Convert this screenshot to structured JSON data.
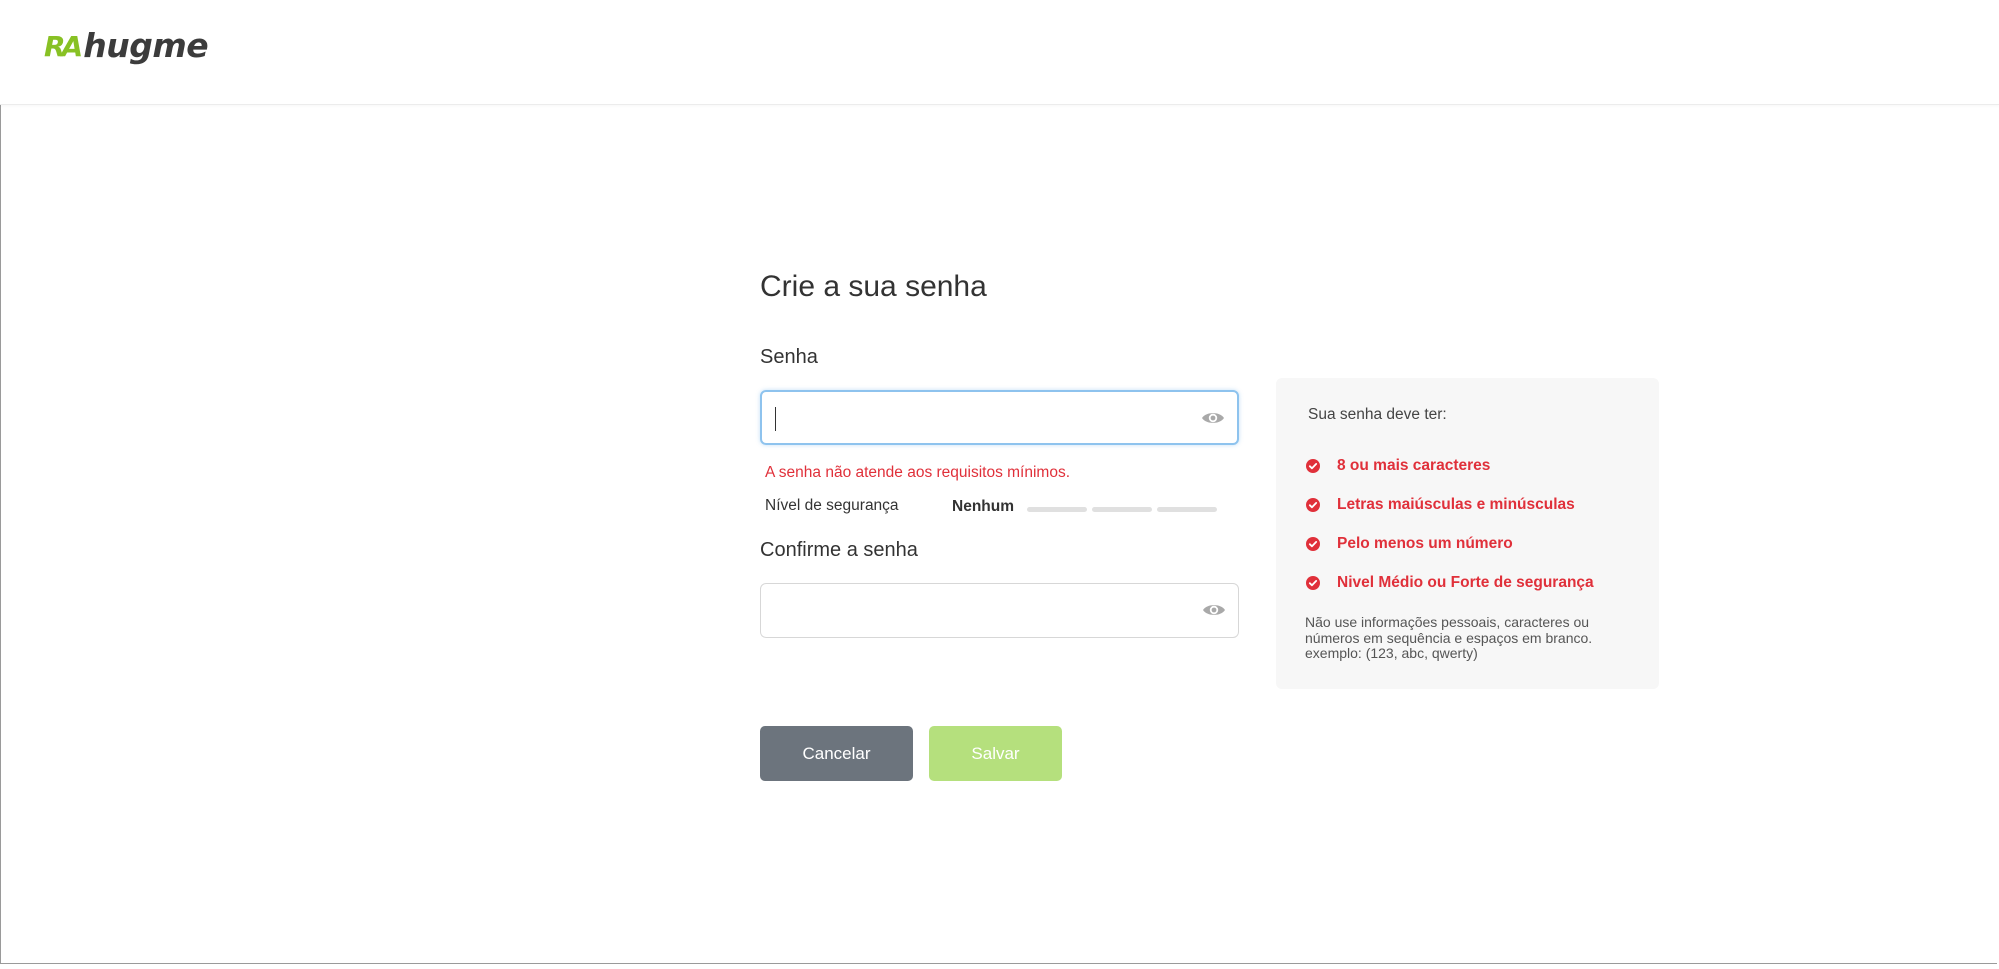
{
  "header": {
    "logo_mark": "RA",
    "logo_text": "hugme"
  },
  "form": {
    "title": "Crie a sua senha",
    "password_label": "Senha",
    "password_value": "",
    "error_message": "A senha não atende aos requisitos mínimos.",
    "strength_label": "Nível de segurança",
    "strength_value": "Nenhum",
    "strength_level": 0,
    "confirm_label": "Confirme a senha",
    "confirm_value": ""
  },
  "requirements": {
    "title": "Sua senha deve ter:",
    "items": [
      "8 ou mais caracteres",
      "Letras maiúsculas e minúsculas",
      "Pelo menos um número",
      "Nivel Médio ou Forte de segurança"
    ],
    "note": "Não use informações pessoais, caracteres ou números em sequência e espaços em branco. exemplo: (123, abc, qwerty)"
  },
  "buttons": {
    "cancel": "Cancelar",
    "save": "Salvar"
  },
  "colors": {
    "error": "#e0303a",
    "cancel_bg": "#6c747d",
    "save_bg": "#b5e07d",
    "focus_border": "#8ec3ee",
    "logo_green": "#88c124"
  },
  "icons": {
    "password_toggle": "eye-icon",
    "requirement": "check-circle-icon"
  }
}
